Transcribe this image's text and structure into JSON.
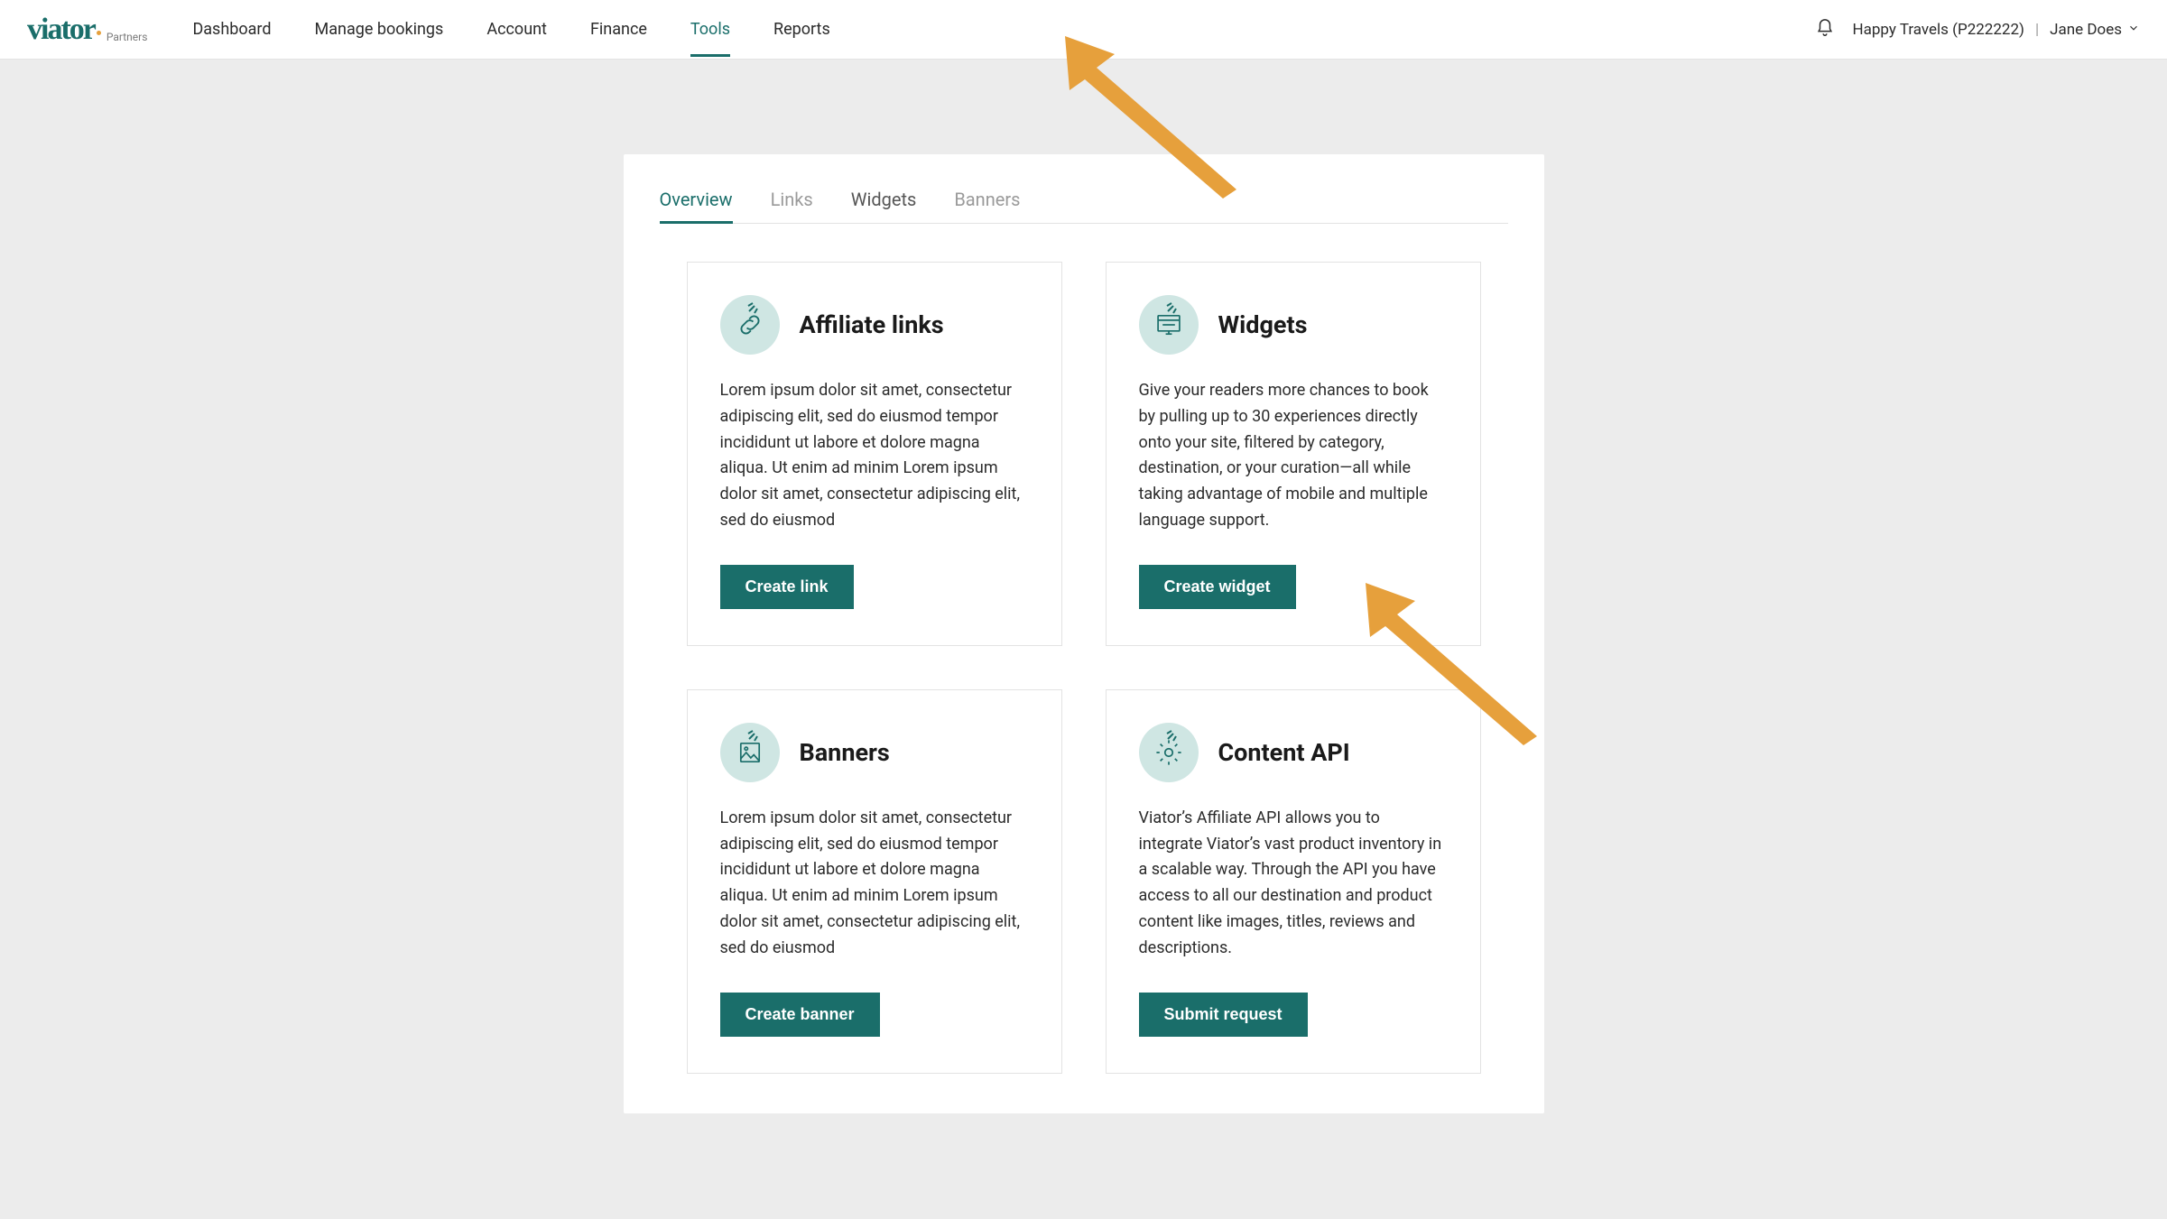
{
  "brand": {
    "logo": "viator",
    "sublogo": "Partners"
  },
  "main_nav": [
    {
      "label": "Dashboard",
      "active": false
    },
    {
      "label": "Manage bookings",
      "active": false
    },
    {
      "label": "Account",
      "active": false
    },
    {
      "label": "Finance",
      "active": false
    },
    {
      "label": "Tools",
      "active": true
    },
    {
      "label": "Reports",
      "active": false
    }
  ],
  "account": {
    "company": "Happy Travels (P222222)",
    "user": "Jane Does"
  },
  "sub_nav": [
    {
      "label": "Overview",
      "state": "active"
    },
    {
      "label": "Links",
      "state": "muted"
    },
    {
      "label": "Widgets",
      "state": "normal"
    },
    {
      "label": "Banners",
      "state": "muted"
    }
  ],
  "cards": {
    "affiliate_links": {
      "title": "Affiliate links",
      "body": "Lorem ipsum dolor sit amet, consectetur adipiscing elit, sed do eiusmod tempor incididunt ut labore et dolore magna aliqua. Ut enim ad minim Lorem ipsum dolor sit amet, consectetur adipiscing elit, sed do eiusmod",
      "button": "Create link"
    },
    "widgets": {
      "title": "Widgets",
      "body": "Give your readers more chances to book by pulling up to 30 experiences directly onto your site, filtered by category, destination, or your curation—all while taking advantage of mobile and multiple language support.",
      "button": "Create widget"
    },
    "banners": {
      "title": "Banners",
      "body": "Lorem ipsum dolor sit amet, consectetur adipiscing elit, sed do eiusmod tempor incididunt ut labore et dolore magna aliqua. Ut enim ad minim Lorem ipsum dolor sit amet, consectetur adipiscing elit, sed do eiusmod",
      "button": "Create banner"
    },
    "content_api": {
      "title": "Content API",
      "body": "Viator’s Affiliate API allows you to integrate Viator’s vast product inventory in a scalable way. Through the API you have access to all our destination and product content like images, titles, reviews and descriptions.",
      "button": "Submit request"
    }
  },
  "colors": {
    "brand": "#1a6e6a",
    "accent": "#e6a03c"
  }
}
